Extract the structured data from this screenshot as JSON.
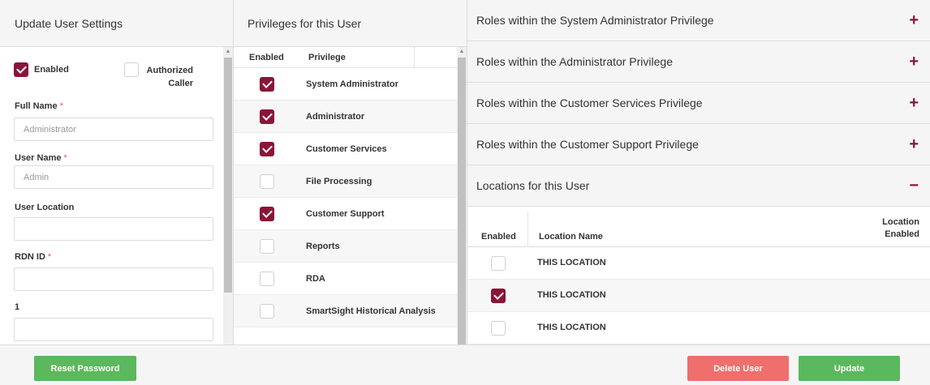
{
  "left_panel": {
    "title": "Update User Settings",
    "enabled_label": "Enabled",
    "enabled_checked": true,
    "authorized_caller_label": "Authorized Caller",
    "authorized_caller_checked": false,
    "fields": {
      "full_name": {
        "label": "Full Name",
        "placeholder": "Administrator",
        "required": true
      },
      "user_name": {
        "label": "User Name",
        "placeholder": "Admin",
        "required": true
      },
      "user_location": {
        "label": "User Location",
        "placeholder": ""
      },
      "rdn_id": {
        "label": "RDN ID",
        "placeholder": "",
        "required": true
      },
      "field_1": {
        "label": "1",
        "placeholder": ""
      }
    },
    "required_marker": "*"
  },
  "middle_panel": {
    "title": "Privileges for this User",
    "columns": {
      "enabled": "Enabled",
      "privilege": "Privilege"
    },
    "privileges": [
      {
        "name": "System Administrator",
        "enabled": true
      },
      {
        "name": "Administrator",
        "enabled": true
      },
      {
        "name": "Customer Services",
        "enabled": true
      },
      {
        "name": "File Processing",
        "enabled": false
      },
      {
        "name": "Customer Support",
        "enabled": true
      },
      {
        "name": "Reports",
        "enabled": false
      },
      {
        "name": "RDA",
        "enabled": false
      },
      {
        "name": "SmartSight Historical Analysis",
        "enabled": false
      }
    ]
  },
  "right_panel": {
    "accordions": [
      {
        "title": "Roles within the System Administrator Privilege",
        "toggle": "+"
      },
      {
        "title": "Roles within the Administrator Privilege",
        "toggle": "+"
      },
      {
        "title": "Roles within the Customer Services Privilege",
        "toggle": "+"
      },
      {
        "title": "Roles within the Customer Support Privilege",
        "toggle": "+"
      },
      {
        "title": "Locations for this User",
        "toggle": "−"
      }
    ],
    "locations": {
      "columns": {
        "enabled": "Enabled",
        "location_name": "Location Name",
        "location_enabled": "Location Enabled"
      },
      "rows": [
        {
          "name": "THIS LOCATION",
          "enabled": false
        },
        {
          "name": "THIS LOCATION",
          "enabled": true
        },
        {
          "name": "THIS LOCATION",
          "enabled": false
        }
      ]
    }
  },
  "footer": {
    "reset_password": "Reset Password",
    "delete_user": "Delete User",
    "update": "Update"
  },
  "colors": {
    "accent": "#8a1538",
    "green_button": "#5cb85c",
    "red_button": "#ef6f6c",
    "header_bg": "#f5f5f5"
  }
}
